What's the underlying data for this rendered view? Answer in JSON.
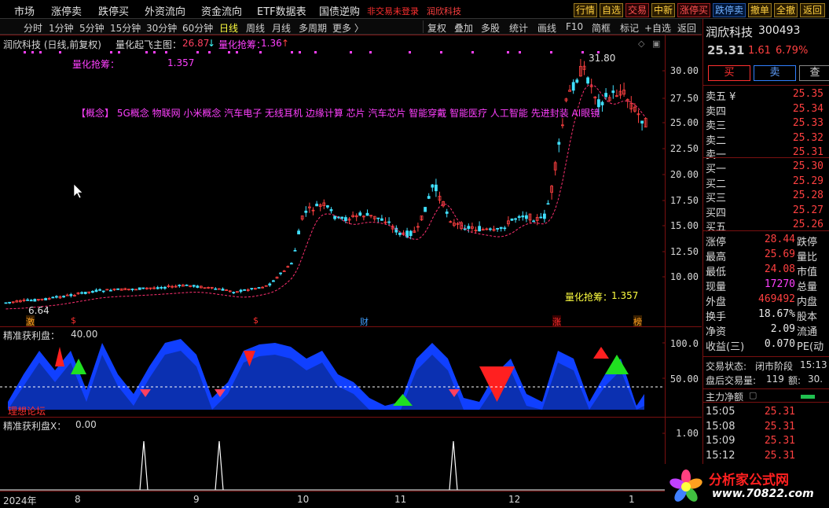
{
  "menu": {
    "items": [
      "市场",
      "涨停卖",
      "跌停买",
      "外资流向",
      "资金流向",
      "ETF数据表",
      "国债逆购"
    ],
    "alert": "非交易未登录",
    "alert_stock": "润欣科技",
    "right_buttons": [
      "行情",
      "自选",
      "交易",
      "中新",
      "涨停买",
      "跌停卖",
      "撤单",
      "全撤",
      "返回"
    ]
  },
  "period_bar": {
    "periods": [
      "分时",
      "1分钟",
      "5分钟",
      "15分钟",
      "30分钟",
      "60分钟",
      "日线",
      "周线",
      "月线",
      "多周期",
      "更多 〉"
    ],
    "active": "日线",
    "tools": [
      "复权",
      "叠加",
      "多股",
      "统计",
      "画线",
      "F10",
      "简框",
      "标记",
      "+自选",
      "返回"
    ]
  },
  "main_chart": {
    "header_stock": "润欣科技 (日线,前复权)",
    "indicator_name": "量化起飞主图：",
    "indicator_value": "26.87",
    "indicator_arrow": "↓",
    "signal_label": "量化抢筹：",
    "signal_value": "1.36",
    "signal_arrow": "↑",
    "sub_label": "量化抢筹：",
    "sub_value": "1.357",
    "concept_text": "【概念】  5G概念 物联网 小米概念 汽车电子 无线耳机 边缘计算 芯片 汽车芯片 智能穿戴 智能医疗 人工智能 先进封装 AI眼镜",
    "high_label": "31.80",
    "low_label": "6.64",
    "bottom_label": "量化抢筹：",
    "bottom_value": "1.357",
    "y_ticks": [
      "30.00",
      "27.50",
      "25.00",
      "22.50",
      "20.00",
      "17.50",
      "15.00",
      "12.50",
      "10.00"
    ],
    "markers": [
      {
        "text": "激",
        "color": "#ffa020"
      },
      {
        "text": "$",
        "color": "#ff3030"
      },
      {
        "text": "$",
        "color": "#ff3030"
      },
      {
        "text": "财",
        "color": "#40a0ff"
      },
      {
        "text": "涨",
        "color": "#ff3030"
      },
      {
        "text": "榜",
        "color": "#ffa020"
      }
    ]
  },
  "sub_chart1": {
    "title": "精准获利盘：",
    "value": "40.00",
    "y_ticks": [
      "100.0",
      "50.00"
    ],
    "watermark": "理想论坛"
  },
  "sub_chart2": {
    "title": "精准获利盘X：",
    "value": "0.00",
    "y_ticks": [
      "1.00"
    ]
  },
  "x_axis": [
    "2024年",
    "8",
    "9",
    "10",
    "11",
    "12",
    "1"
  ],
  "quote": {
    "name": "润欣科技",
    "code": "300493",
    "price": "25.31",
    "change": "1.61",
    "pct": "6.79%",
    "buy_label": "买",
    "sell_label": "卖",
    "more_label": "查",
    "asks": [
      {
        "label": "卖五 ¥",
        "price": "25.35"
      },
      {
        "label": "卖四",
        "price": "25.34"
      },
      {
        "label": "卖三",
        "price": "25.33"
      },
      {
        "label": "卖二",
        "price": "25.32"
      },
      {
        "label": "卖一",
        "price": "25.31"
      }
    ],
    "bids": [
      {
        "label": "买一",
        "price": "25.30"
      },
      {
        "label": "买二",
        "price": "25.29"
      },
      {
        "label": "买三",
        "price": "25.28"
      },
      {
        "label": "买四",
        "price": "25.27"
      },
      {
        "label": "买五",
        "price": "25.26"
      }
    ],
    "stats": [
      {
        "k": "涨停",
        "v": "28.44",
        "k2": "跌停",
        "c": "red"
      },
      {
        "k": "最高",
        "v": "25.69",
        "k2": "量比",
        "c": "red"
      },
      {
        "k": "最低",
        "v": "24.08",
        "k2": "市值",
        "c": "red"
      },
      {
        "k": "现量",
        "v": "17270",
        "k2": "总量",
        "c": "mag"
      },
      {
        "k": "外盘",
        "v": "469492",
        "k2": "内盘",
        "c": "red"
      },
      {
        "k": "换手",
        "v": "18.67%",
        "k2": "股本",
        "c": "white"
      },
      {
        "k": "净资",
        "v": "2.09",
        "k2": "流通",
        "c": "white"
      },
      {
        "k": "收益(三)",
        "v": "0.070",
        "k2": "PE(动",
        "c": "white"
      }
    ],
    "trade_status_label": "交易状态:",
    "trade_status": "闭市阶段",
    "trade_status_time": "15:13",
    "after_hours_label": "盘后交易量:",
    "after_hours_vol": "119",
    "after_hours_amt_label": "额:",
    "after_hours_amt": "30.",
    "main_flow_label": "主力净额",
    "ticks": [
      {
        "t": "15:05",
        "p": "25.31"
      },
      {
        "t": "15:08",
        "p": "25.31"
      },
      {
        "t": "15:09",
        "p": "25.31"
      },
      {
        "t": "15:12",
        "p": "25.31"
      }
    ]
  },
  "logo": {
    "name": "分析家公式网",
    "url": "www.70822.com"
  }
}
